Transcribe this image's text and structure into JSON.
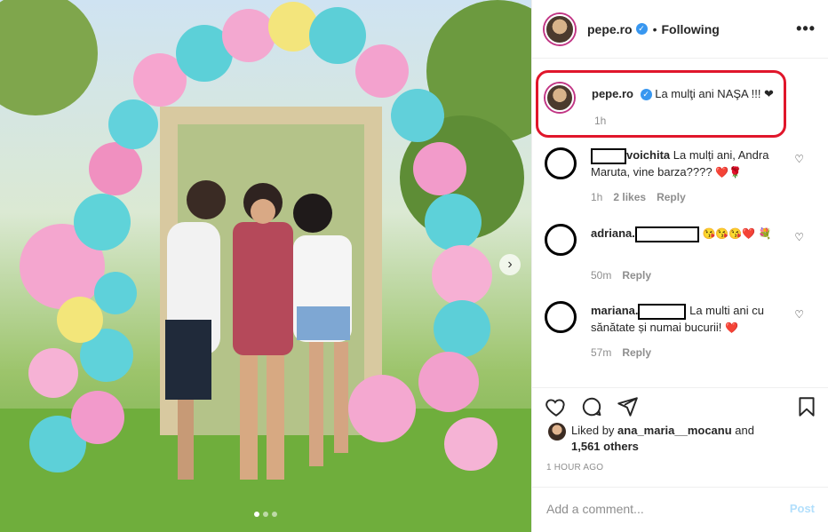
{
  "post": {
    "carousel": {
      "slide_count": 3,
      "active_slide": 1
    },
    "header": {
      "username": "pepe.ro",
      "verified_icon": "verified-badge-icon",
      "separator": "•",
      "follow_status": "Following",
      "more_icon": "more-horizontal-icon"
    },
    "caption": {
      "username": "pepe.ro",
      "text": "La mulţi ani NAŞA !!! ❤",
      "time": "1h"
    },
    "comments": [
      {
        "username": "voichita",
        "text": "La mulți ani, Andra Maruta, vine barza????",
        "emoji": "❤️🌹",
        "time": "1h",
        "likes": "2 likes",
        "reply": "Reply"
      },
      {
        "username": "adriana.",
        "text": "",
        "emoji": "😘😘😘❤️ 💐",
        "time": "50m",
        "reply": "Reply"
      },
      {
        "username": "mariana.",
        "text": "La multi ani cu sănătate și numai bucurii!",
        "emoji": "❤️",
        "time": "57m",
        "reply": "Reply"
      }
    ],
    "likes": {
      "prefix": "Liked by",
      "user": "ana_maria__mocanu",
      "joiner": "and",
      "others": "1,561 others"
    },
    "time_ago": "1 HOUR AGO",
    "add_comment": {
      "placeholder": "Add a comment...",
      "post_label": "Post"
    }
  },
  "colors": {
    "highlight_border": "#e0162b",
    "verified": "#3897f0",
    "post_button": "#b2dffc",
    "muted": "#8e8e8e"
  }
}
